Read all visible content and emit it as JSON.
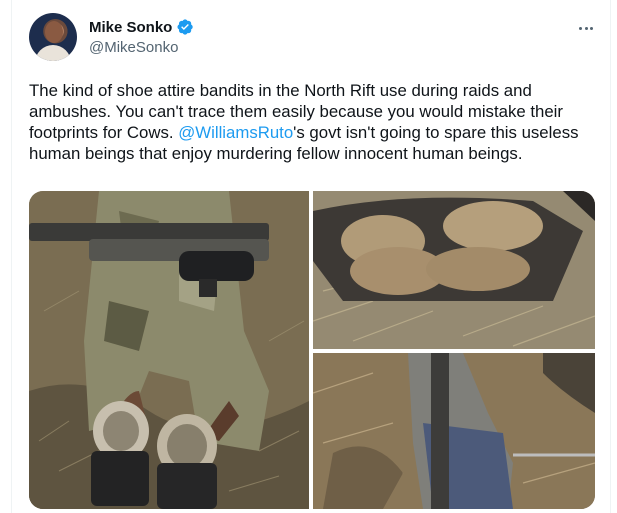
{
  "tweet": {
    "author_name": "Mike Sonko",
    "author_handle": "@MikeSonko",
    "text_before": "The kind of shoe attire bandits in the North Rift use during raids and ambushes. You can't trace them easily because you would mistake their footprints for Cows. ",
    "mention": "@WilliamsRuto",
    "text_after": "'s govt isn't going to spare this useless human beings that enjoy murdering fellow innocent human beings."
  },
  "icons": {
    "verified": "verified-badge-icon",
    "more": "more-options-icon"
  },
  "colors": {
    "accent": "#1d9bf0",
    "text": "#0f1419",
    "secondary_text": "#536471"
  }
}
